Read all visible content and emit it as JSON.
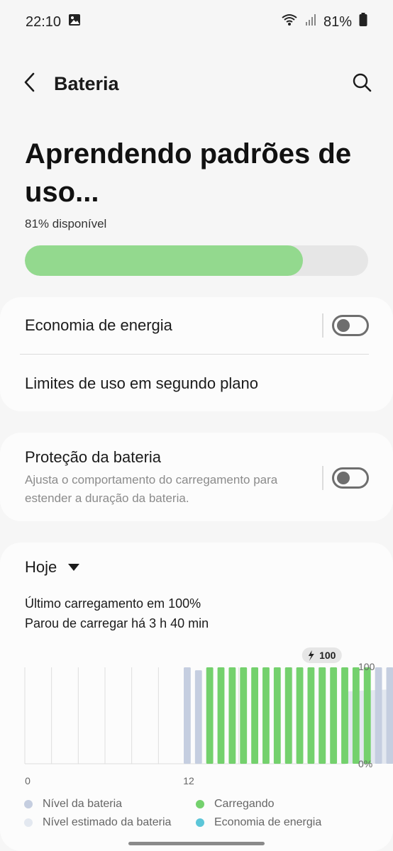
{
  "status": {
    "time": "22:10",
    "battery_percent": "81%"
  },
  "app_bar": {
    "title": "Bateria"
  },
  "headline": "Aprendendo padrões de uso...",
  "available_text": "81% disponível",
  "battery_level": 0.81,
  "settings": {
    "power_saving": {
      "label": "Economia de energia",
      "enabled": false
    },
    "background_limits": {
      "label": "Limites de uso em segundo plano"
    },
    "battery_protection": {
      "label": "Proteção da bateria",
      "description": "Ajusta o comportamento do carregamento para estender a duração da bateria.",
      "enabled": false
    }
  },
  "usage": {
    "period": "Hoje",
    "last_charge": "Último carregamento em 100%",
    "stopped_charging": "Parou de carregar há 3 h 40 min"
  },
  "chart_data": {
    "type": "bar",
    "x_tick_labels": [
      "0",
      "12"
    ],
    "y_tick_labels": [
      "100",
      "0%"
    ],
    "ylim": [
      0,
      100
    ],
    "peak_label": "100",
    "series": [
      {
        "name": "Nível da bateria",
        "start_hour": 12,
        "values": [
          100,
          97,
          100,
          100,
          100,
          100,
          100,
          100,
          100,
          100,
          100,
          100,
          100,
          100,
          100,
          100,
          100,
          100,
          100,
          97,
          94,
          91,
          88,
          85,
          83,
          81
        ]
      },
      {
        "name": "Carregando",
        "charging_flags": [
          0,
          0,
          1,
          1,
          1,
          1,
          1,
          1,
          1,
          1,
          1,
          1,
          1,
          1,
          1,
          1,
          1,
          0,
          0,
          0,
          0,
          0,
          0,
          0,
          0,
          0
        ]
      },
      {
        "name": "Nível estimado da bateria",
        "values": [
          81,
          75
        ]
      }
    ],
    "legend": [
      {
        "label": "Nível da bateria",
        "color": "#c5cee0"
      },
      {
        "label": "Carregando",
        "color": "#74d16d"
      },
      {
        "label": "Nível estimado da bateria",
        "color": "#e3e8f0"
      },
      {
        "label": "Economia de energia",
        "color": "#5cc6d8"
      }
    ]
  }
}
